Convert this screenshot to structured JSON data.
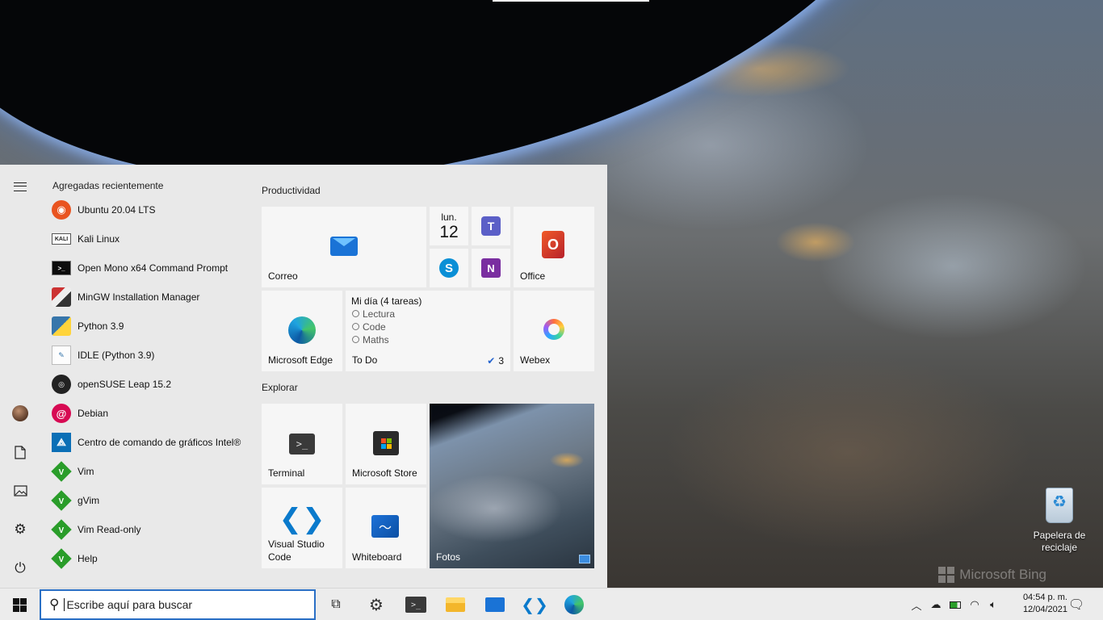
{
  "desktop": {
    "watermark": "Microsoft Bing",
    "recycle_bin_label": "Papelera de reciclaje"
  },
  "start_menu": {
    "recent_header": "Agregadas recientemente",
    "apps": [
      {
        "label": "Ubuntu 20.04 LTS",
        "icon": "ubuntu-icon",
        "glyph": "◉"
      },
      {
        "label": "Kali Linux",
        "icon": "kali-icon",
        "glyph": "KALI"
      },
      {
        "label": "Open Mono x64 Command Prompt",
        "icon": "command-prompt-icon",
        "glyph": ">_"
      },
      {
        "label": "MinGW Installation Manager",
        "icon": "mingw-icon",
        "glyph": ""
      },
      {
        "label": "Python 3.9",
        "icon": "python-icon",
        "glyph": ""
      },
      {
        "label": "IDLE (Python 3.9)",
        "icon": "idle-icon",
        "glyph": "✎"
      },
      {
        "label": "openSUSE Leap 15.2",
        "icon": "opensuse-icon",
        "glyph": "◎"
      },
      {
        "label": "Debian",
        "icon": "debian-icon",
        "glyph": "@"
      },
      {
        "label": "Centro de comando de gráficos Intel®",
        "icon": "intel-graphics-icon",
        "glyph": "⟁"
      },
      {
        "label": "Vim",
        "icon": "vim-icon",
        "glyph": "V"
      },
      {
        "label": "gVim",
        "icon": "vim-icon",
        "glyph": "V"
      },
      {
        "label": "Vim Read-only",
        "icon": "vim-icon",
        "glyph": "V"
      },
      {
        "label": "Help",
        "icon": "vim-icon",
        "glyph": "V"
      }
    ],
    "groups": {
      "productivity": "Productividad",
      "explore": "Explorar"
    },
    "tiles": {
      "mail": "Correo",
      "calendar_day": "lun.",
      "calendar_num": "12",
      "office": "Office",
      "edge": "Microsoft Edge",
      "todo_title": "Mi día (4 tareas)",
      "todo_items": [
        "Lectura",
        "Code",
        "Maths"
      ],
      "todo_label": "To Do",
      "todo_count": "3",
      "webex": "Webex",
      "terminal": "Terminal",
      "store": "Microsoft Store",
      "vscode": "Visual Studio Code",
      "whiteboard": "Whiteboard",
      "photos": "Fotos"
    }
  },
  "taskbar": {
    "search_placeholder": "Escribe aquí para buscar",
    "time": "04:54 p. m.",
    "date": "12/04/2021"
  }
}
